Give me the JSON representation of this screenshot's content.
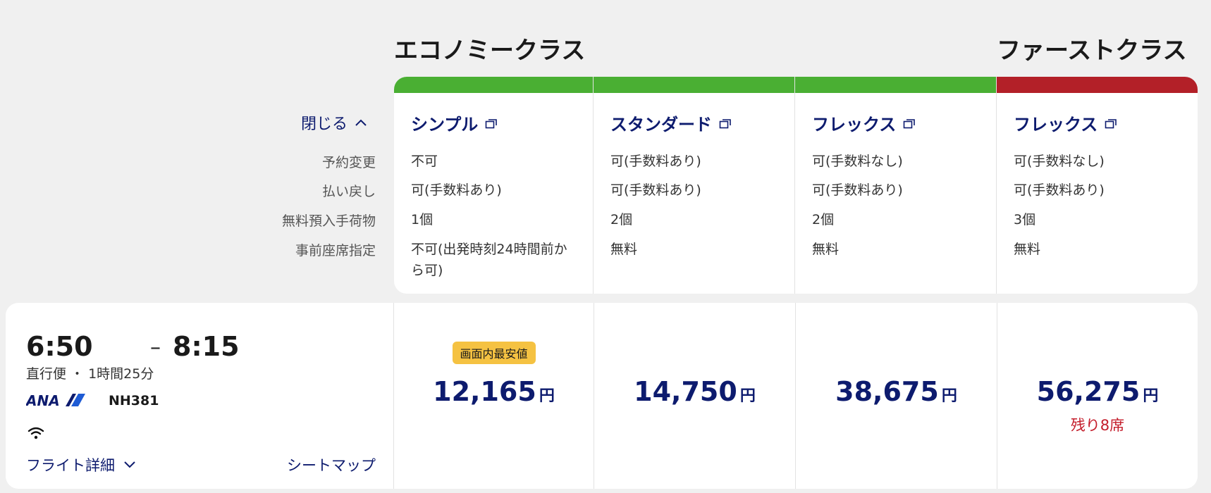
{
  "cabins": {
    "economy": "エコノミークラス",
    "first": "ファーストクラス"
  },
  "colors": {
    "economy_bar": "#4aaf33",
    "first_bar": "#b32028",
    "brand_navy": "#0d1b6e",
    "badge": "#f5c242",
    "alert_red": "#c41d2b"
  },
  "toggle": {
    "label": "閉じる",
    "icon": "chevron-up-icon"
  },
  "row_labels": [
    "予約変更",
    "払い戻し",
    "無料預入手荷物",
    "事前座席指定"
  ],
  "fares": [
    {
      "name": "シンプル",
      "cabin": "economy",
      "change": "不可",
      "refund": "可(手数料あり)",
      "baggage": "1個",
      "seat": "不可(出発時刻24時間前から可)",
      "price": "12,165",
      "currency": "円",
      "badge": "画面内最安値",
      "note": ""
    },
    {
      "name": "スタンダード",
      "cabin": "economy",
      "change": "可(手数料あり)",
      "refund": "可(手数料あり)",
      "baggage": "2個",
      "seat": "無料",
      "price": "14,750",
      "currency": "円",
      "badge": "",
      "note": ""
    },
    {
      "name": "フレックス",
      "cabin": "economy",
      "change": "可(手数料なし)",
      "refund": "可(手数料あり)",
      "baggage": "2個",
      "seat": "無料",
      "price": "38,675",
      "currency": "円",
      "badge": "",
      "note": ""
    },
    {
      "name": "フレックス",
      "cabin": "first",
      "change": "可(手数料なし)",
      "refund": "可(手数料あり)",
      "baggage": "3個",
      "seat": "無料",
      "price": "56,275",
      "currency": "円",
      "badge": "",
      "note": "残り8席"
    }
  ],
  "flight": {
    "depart": "6:50",
    "separator": "–",
    "arrive": "8:15",
    "meta": "直行便 ・ 1時間25分",
    "airline": "ANA",
    "number": "NH381",
    "wifi_icon": "wifi-icon",
    "detail_link": "フライト詳細",
    "seat_map_link": "シートマップ"
  }
}
